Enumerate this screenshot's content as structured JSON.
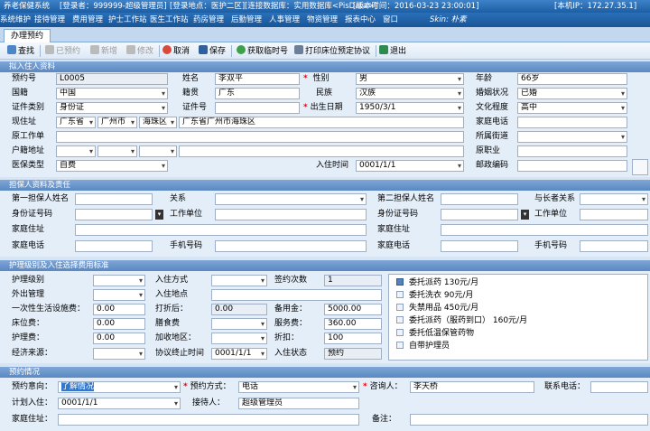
{
  "titlebar": {
    "app": "养老保健系统",
    "user": "[登录者：999999-超级管理员]",
    "location": "[登录地点：医护二区]",
    "db": "[连接数据库：实用数据库<PisData>]",
    "version": "[版本时间：2016-03-23 23:00:01]",
    "ip": "[本机IP：172.27.35.1]"
  },
  "menu": [
    "系统维护",
    "接待管理",
    "费用管理",
    "护士工作站",
    "医生工作站",
    "药房管理",
    "后勤管理",
    "人事管理",
    "物资管理",
    "报表中心",
    "窗口"
  ],
  "skin": "Skin: 朴素",
  "tab": "办理预约",
  "toolbar": {
    "search": "查找",
    "booked": "已预约",
    "new": "新增",
    "edit": "修改",
    "cancel": "取消",
    "save": "保存",
    "get_temp": "获取临时号",
    "print_protocol": "打印床位预定协议",
    "exit": "退出"
  },
  "sections": {
    "resident": "拟入住人资料",
    "guarantor": "担保人资料及责任",
    "care": "护理级别及入住选择费用标准",
    "booking": "预约情况"
  },
  "resident": {
    "labels": {
      "booking_no": "预约号",
      "name": "姓名",
      "gender": "性别",
      "age": "年龄",
      "nationality": "国籍",
      "native": "籍贯",
      "ethnicity": "民族",
      "marital": "婚姻状况",
      "id_type": "证件类别",
      "id_no": "证件号",
      "birth": "出生日期",
      "education": "文化程度",
      "address": "现住址",
      "home_phone": "家庭电话",
      "prev_work": "原工作单",
      "street": "所属街道",
      "huji": "户籍地址",
      "prev_job": "原职业",
      "insurance": "医保类型",
      "checkin": "入住时间",
      "postcode": "邮政编码"
    },
    "values": {
      "booking_no": "L0005",
      "name": "李双平",
      "gender": "男",
      "age": "66岁",
      "nationality": "中国",
      "native": "广东",
      "ethnicity": "汉族",
      "marital": "已婚",
      "id_type": "身份证",
      "id_no": "",
      "birth": "1950/3/1",
      "education": "高中",
      "province": "广东省",
      "city": "广州市",
      "district": "海珠区",
      "address": "广东省广州市海珠区",
      "home_phone": "",
      "prev_work": "",
      "street": "",
      "huji": "",
      "prev_job": "",
      "insurance": "自费",
      "checkin": "0001/1/1",
      "postcode": ""
    }
  },
  "guarantor": {
    "labels": {
      "first_name": "第一担保人姓名",
      "relation": "关系",
      "id_no": "身份证号码",
      "work": "工作单位",
      "address": "家庭住址",
      "phone": "家庭电话",
      "mobile": "手机号码",
      "second_name": "第二担保人姓名",
      "relation_elder": "与长者关系"
    }
  },
  "care": {
    "labels": {
      "level": "护理级别",
      "checkin_method": "入住方式",
      "sign_count": "签约次数",
      "outside": "外出管理",
      "checkin_place": "入住地点",
      "one_time": "一次性生活设施费：",
      "discount": "打折后：",
      "deposit": "备用金：",
      "bed_fee": "床位费：",
      "meal_fee": "膳食费",
      "service_fee": "服务费：",
      "care_fee": "护理费：",
      "extra_area": "加收地区：",
      "rebate": "折扣：",
      "source": "经济来源：",
      "end_time": "协议终止时间",
      "status": "入住状态"
    },
    "values": {
      "sign_count": "1",
      "one_time": "0.00",
      "discount": "0.00",
      "deposit": "5000.00",
      "bed_fee": "0.00",
      "service_fee": "360.00",
      "care_fee": "0.00",
      "rebate": "100",
      "end_time": "0001/1/1",
      "status": "预约"
    },
    "services": [
      "委托派药 130元/月",
      "委托洗衣 90元/月",
      "失禁用品 450元/月",
      "委托派药（服药到口） 160元/月",
      "委托低温保管药物",
      "自带护理员"
    ]
  },
  "booking": {
    "labels": {
      "intention": "预约意向：",
      "method": "预约方式：",
      "consultant": "咨询人：",
      "contact": "联系电话：",
      "plan_date": "计划入住：",
      "receiver": "接待人：",
      "address": "家庭住址：",
      "remark": "备注："
    },
    "values": {
      "intention": "了解情况",
      "method": "电话",
      "consultant": "李天桥",
      "contact": "",
      "plan_date": "0001/1/1",
      "receiver": "超级管理员",
      "address": "",
      "remark": ""
    }
  },
  "colors": {
    "title": "#1d5ea4",
    "section": "#5a88c2",
    "panel": "#e4eef9",
    "required": "#ee0000",
    "highlight": "#3378cc"
  }
}
